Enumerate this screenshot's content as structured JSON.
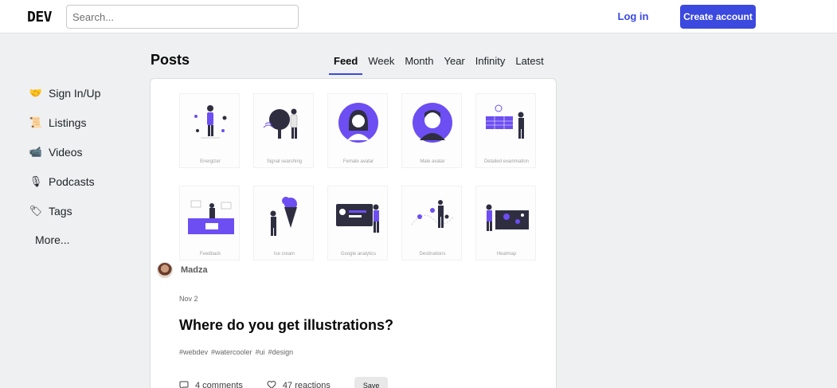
{
  "header": {
    "logo": "DEV",
    "search_placeholder": "Search...",
    "login_label": "Log in",
    "create_label": "Create account"
  },
  "sidebar": {
    "items": [
      {
        "label": "Sign In/Up",
        "icon": "handshake-icon",
        "glyph": "🤝"
      },
      {
        "label": "Listings",
        "icon": "scroll-icon",
        "glyph": "📜"
      },
      {
        "label": "Videos",
        "icon": "video-camera-icon",
        "glyph": "📹"
      },
      {
        "label": "Podcasts",
        "icon": "microphone-icon",
        "glyph": "🎙"
      },
      {
        "label": "Tags",
        "icon": "tag-icon",
        "glyph": "🏷"
      }
    ],
    "more_label": "More..."
  },
  "feed": {
    "title": "Posts",
    "tabs": [
      "Feed",
      "Week",
      "Month",
      "Year",
      "Infinity",
      "Latest"
    ],
    "active_tab": "Feed"
  },
  "post": {
    "cover_captions": [
      "Energizer",
      "Signal searching",
      "Female avatar",
      "Male avatar",
      "Detailed examination",
      "Feedback",
      "Ice cream",
      "Google analytics",
      "Destinations",
      "Heatmap"
    ],
    "author": "Madza",
    "date": "Nov 2",
    "title": "Where do you get illustrations?",
    "tags": [
      "#webdev",
      "#watercooler",
      "#ui",
      "#design"
    ],
    "comments_label": "4 comments",
    "reactions_label": "47 reactions",
    "save_label": "Save"
  },
  "colors": {
    "accent": "#3b49df",
    "illustration": "#6c4ef2"
  }
}
